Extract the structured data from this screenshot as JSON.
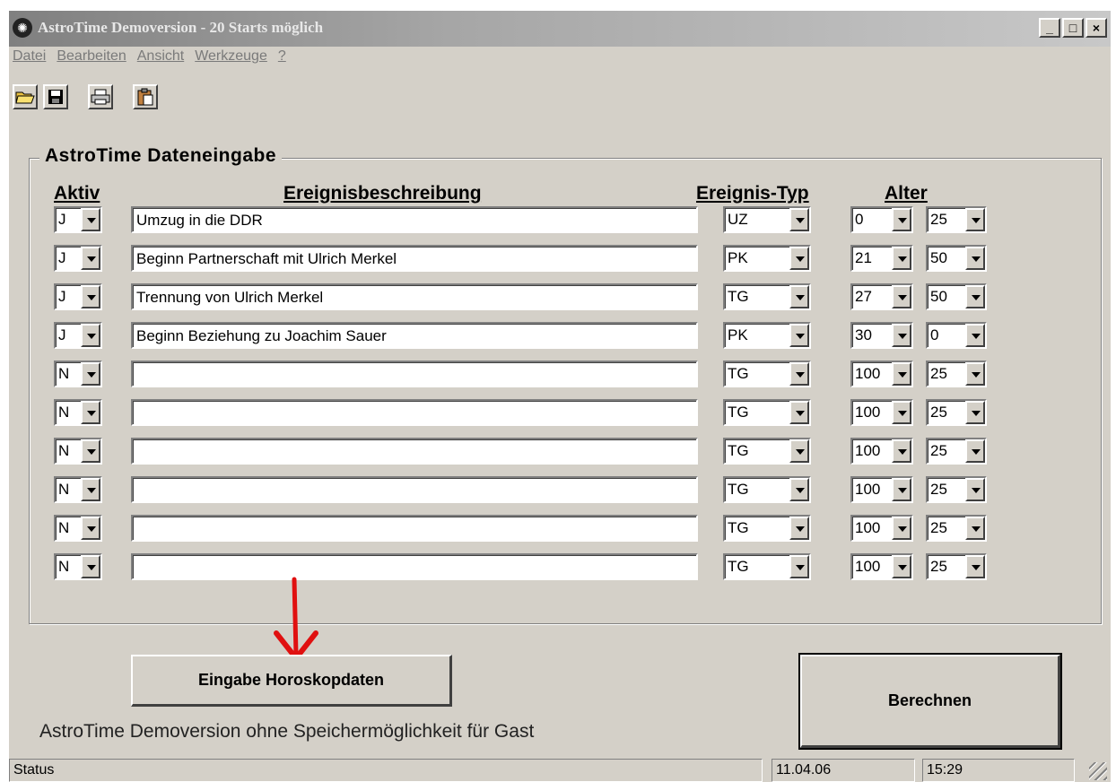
{
  "window": {
    "title": "AstroTime Demoversion - 20 Starts möglich",
    "buttons": {
      "minimize": "_",
      "maximize": "□",
      "close": "×"
    }
  },
  "menu": [
    "Datei",
    "Bearbeiten",
    "Ansicht",
    "Werkzeuge",
    "?"
  ],
  "toolbar": [
    "open-folder-icon",
    "save-icon",
    "print-icon",
    "clipboard-icon"
  ],
  "form": {
    "group_title": "AstroTime  Dateneingabe",
    "headers": {
      "aktiv": "Aktiv",
      "beschreibung": "Ereignisbeschreibung",
      "typ": "Ereignis-Typ",
      "alter": "Alter"
    },
    "rows": [
      {
        "aktiv": "J",
        "beschreibung": "Umzug in die DDR",
        "typ": "UZ",
        "alter_von": "0",
        "alter_bis": "25"
      },
      {
        "aktiv": "J",
        "beschreibung": "Beginn Partnerschaft mit Ulrich Merkel",
        "typ": "PK",
        "alter_von": "21",
        "alter_bis": "50"
      },
      {
        "aktiv": "J",
        "beschreibung": "Trennung von Ulrich Merkel",
        "typ": "TG",
        "alter_von": "27",
        "alter_bis": "50"
      },
      {
        "aktiv": "J",
        "beschreibung": "Beginn Beziehung zu Joachim Sauer",
        "typ": "PK",
        "alter_von": "30",
        "alter_bis": "0"
      },
      {
        "aktiv": "N",
        "beschreibung": "",
        "typ": "TG",
        "alter_von": "100",
        "alter_bis": "25"
      },
      {
        "aktiv": "N",
        "beschreibung": "",
        "typ": "TG",
        "alter_von": "100",
        "alter_bis": "25"
      },
      {
        "aktiv": "N",
        "beschreibung": "",
        "typ": "TG",
        "alter_von": "100",
        "alter_bis": "25"
      },
      {
        "aktiv": "N",
        "beschreibung": "",
        "typ": "TG",
        "alter_von": "100",
        "alter_bis": "25"
      },
      {
        "aktiv": "N",
        "beschreibung": "",
        "typ": "TG",
        "alter_von": "100",
        "alter_bis": "25"
      },
      {
        "aktiv": "N",
        "beschreibung": "",
        "typ": "TG",
        "alter_von": "100",
        "alter_bis": "25"
      }
    ]
  },
  "buttons": {
    "horoskop": "Eingabe Horoskopdaten",
    "berechnen": "Berechnen"
  },
  "info_text": "AstroTime Demoversion ohne Speichermöglichkeit für Gast",
  "statusbar": {
    "status": "Status",
    "date": "11.04.06",
    "time": "15:29"
  },
  "colors": {
    "window_bg": "#d4d0c8",
    "arrow": "#e01010",
    "titlebar_inactive": "#a6a6a6"
  }
}
